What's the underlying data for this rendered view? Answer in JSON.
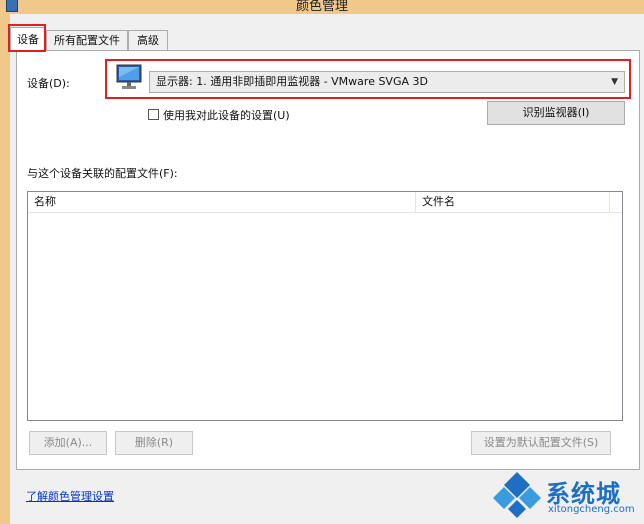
{
  "window": {
    "title": "颜色管理"
  },
  "tabs": [
    {
      "label": "设备",
      "active": true
    },
    {
      "label": "所有配置文件",
      "active": false
    },
    {
      "label": "高级",
      "active": false
    }
  ],
  "device": {
    "label": "设备(D):",
    "selected": "显示器: 1. 通用非即插即用监视器 - VMware SVGA 3D",
    "icon": "monitor-icon"
  },
  "use_my_settings": {
    "label": "使用我对此设备的设置(U)",
    "checked": false
  },
  "identify_button": "识别监视器(I)",
  "profiles_label": "与这个设备关联的配置文件(F):",
  "profiles_table": {
    "columns": [
      "名称",
      "文件名"
    ],
    "rows": []
  },
  "buttons": {
    "add": "添加(A)...",
    "remove": "删除(R)",
    "set_default": "设置为默认配置文件(S)"
  },
  "link": "了解颜色管理设置",
  "watermark": {
    "text": "系统城",
    "sub": "xitongcheng.com"
  },
  "colors": {
    "titlebar": "#f0c88a",
    "highlight": "#e02020",
    "link": "#0033cc",
    "watermark": "#1d6fc4"
  }
}
